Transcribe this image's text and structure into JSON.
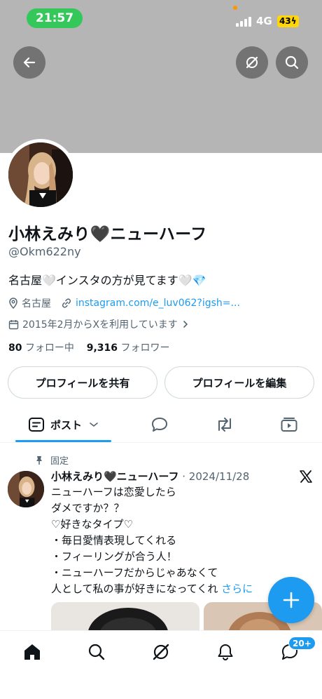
{
  "status_bar": {
    "time": "21:57",
    "network": "4G",
    "battery": "43"
  },
  "profile": {
    "display_name": "小林えみり🖤ニューハーフ",
    "handle": "@Okm622ny",
    "bio": "名古屋🤍インスタの方が見てます🤍💎",
    "location": "名古屋",
    "link": "instagram.com/e_luv062?igsh=...",
    "joined": "2015年2月からXを利用しています",
    "following_count": "80",
    "following_label": "フォロー中",
    "followers_count": "9,316",
    "followers_label": "フォロワー"
  },
  "buttons": {
    "share_profile": "プロフィールを共有",
    "edit_profile": "プロフィールを編集"
  },
  "tabs": {
    "posts_label": "ポスト"
  },
  "pinned_post": {
    "pinned_label": "固定",
    "author": "小林えみり🖤ニューハーフ",
    "date": "· 2024/11/28",
    "lines": [
      "ニューハーフは恋愛したら",
      "ダメですか？？",
      "♡好きなタイプ♡",
      "・毎日愛情表現してくれる",
      "・フィーリングが合う人！",
      "・ニューハーフだからじゃあなくて",
      "人として私の事が好きになってくれ"
    ],
    "more_label": "さらに"
  },
  "nav": {
    "messages_badge": "20+"
  },
  "colors": {
    "accent": "#1d9bf0",
    "banner": "#b5b5b5",
    "status_time_bg": "#34c759",
    "battery": "#ffd60a"
  },
  "icons": [
    "back-arrow-icon",
    "grok-icon",
    "search-icon",
    "location-icon",
    "link-icon",
    "calendar-icon",
    "chevron-right-icon",
    "posts-icon",
    "chevron-down-icon",
    "reply-icon",
    "repost-icon",
    "video-icon",
    "pin-icon",
    "x-logo-icon",
    "plus-icon",
    "home-icon",
    "notifications-icon",
    "messages-icon"
  ]
}
